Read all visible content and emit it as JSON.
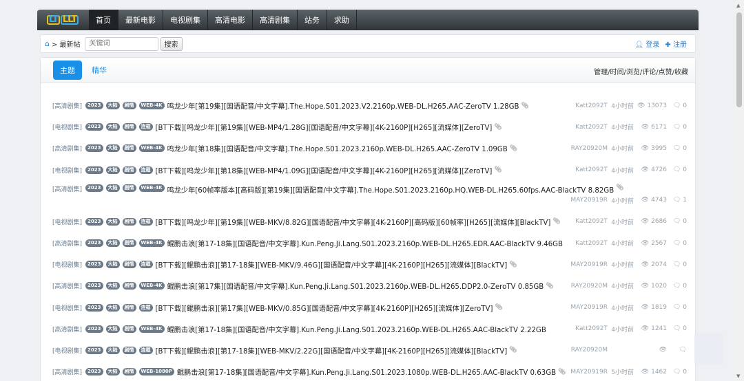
{
  "nav": {
    "logo": "LT LLT",
    "items": [
      "首页",
      "最新电影",
      "电视剧集",
      "高清电影",
      "高清剧集",
      "站务",
      "求助"
    ]
  },
  "subbar": {
    "breadcrumb": "> 最新帖",
    "search_placeholder": "关键词",
    "search_button": "搜索",
    "login": "登录",
    "register": "注册"
  },
  "tabs": {
    "main": "主题",
    "featured": "精华",
    "sort_options": "管理/时间/浏览/评论/点赞/收藏"
  },
  "colors": {
    "accent": "#1a8fe8",
    "nav_bg": "#2f3437",
    "tag_bg": "#6c7a87"
  },
  "posts": [
    {
      "cat": "[高清剧集]",
      "tags": [
        "2023",
        "大陆",
        "剧情",
        "WEB-4K"
      ],
      "title": "鸣龙少年[第19集][国语配音/中文字幕].The.Hope.S01.2023.V2.2160p.WEB-DL.H265.AAC-ZeroTV 1.28GB",
      "author": "Katt2092T",
      "time": "4小时前",
      "views": "13073",
      "comments": "0"
    },
    {
      "cat": "[电视剧集]",
      "tags": [
        "2023",
        "大陆",
        "剧情",
        "连载"
      ],
      "title": "[BT下载][鸣龙少年][第19集][WEB-MP4/1.28G][国语配音/中文字幕][4K-2160P][H265][流媒体][ZeroTV]",
      "author": "Katt2092T",
      "time": "4小时前",
      "views": "6171",
      "comments": "0"
    },
    {
      "cat": "[高清剧集]",
      "tags": [
        "2023",
        "大陆",
        "剧情",
        "WEB-4K"
      ],
      "title": "鸣龙少年[第18集][国语配音/中文字幕].The.Hope.S01.2023.2160p.WEB-DL.H265.AAC-ZeroTV 1.09GB",
      "author": "RAY20920M",
      "time": "4小时前",
      "views": "3995",
      "comments": "0"
    },
    {
      "cat": "[电视剧集]",
      "tags": [
        "2023",
        "大陆",
        "剧情",
        "连载"
      ],
      "title": "[BT下载][鸣龙少年][第18集][WEB-MP4/1.09G][国语配音/中文字幕][4K-2160P][H265][流媒体][ZeroTV]",
      "author": "Katt2092T",
      "time": "4小时前",
      "views": "4726",
      "comments": "0"
    },
    {
      "cat": "[高清剧集]",
      "tags": [
        "2023",
        "大陆",
        "剧情",
        "WEB-4K"
      ],
      "title": "鸣龙少年[60帧率版本][高码版][第19集][国语配音/中文字幕].The.Hope.S01.2023.2160p.HQ.WEB-DL.H265.60fps.AAC-BlackTV 8.82GB",
      "author": "MAY20919R",
      "time": "4小时前",
      "views": "4743",
      "comments": "1",
      "two": true
    },
    {
      "cat": "[电视剧集]",
      "tags": [
        "2023",
        "大陆",
        "剧情",
        "连载"
      ],
      "title": "[BT下载][鸣龙少年][第19集][WEB-MKV/8.82G][国语配音/中文字幕][4K-2160P][高码版][60帧率][H265][流媒体][BlackTV]",
      "author": "Katt2092T",
      "time": "4小时前",
      "views": "2686",
      "comments": "0"
    },
    {
      "cat": "[高清剧集]",
      "tags": [
        "2023",
        "大陆",
        "剧情",
        "WEB-4K"
      ],
      "title": "鲲鹏击浪[第17-18集][国语配音/中文字幕].Kun.Peng.Ji.Lang.S01.2023.2160p.WEB-DL.H265.EDR.AAC-BlackTV 9.46GB",
      "author": "Katt2092T",
      "time": "4小时前",
      "views": "2567",
      "comments": "0",
      "noclip": true
    },
    {
      "cat": "[电视剧集]",
      "tags": [
        "2023",
        "大陆",
        "剧情",
        "连载"
      ],
      "title": "[BT下载][鲲鹏击浪][第17-18集][WEB-MKV/9.46G][国语配音/中文字幕][4K-2160P][H265][流媒体][BlackTV]",
      "author": "MAY20919R",
      "time": "4小时前",
      "views": "2074",
      "comments": "0"
    },
    {
      "cat": "[高清剧集]",
      "tags": [
        "2023",
        "大陆",
        "剧情",
        "WEB-4K"
      ],
      "title": "鲲鹏击浪[第17集][国语配音/中文字幕].Kun.Peng.Ji.Lang.S01.2023.2160p.WEB-DL.H265.DDP2.0-ZeroTV 0.85GB",
      "author": "RAY20920M",
      "time": "4小时前",
      "views": "1020",
      "comments": "0"
    },
    {
      "cat": "[电视剧集]",
      "tags": [
        "2023",
        "大陆",
        "剧情",
        "连载"
      ],
      "title": "[BT下载][鲲鹏击浪][第17集][WEB-MKV/0.85G][国语配音/中文字幕][4K-2160P][H265][流媒体][ZeroTV]",
      "author": "MAY20919R",
      "time": "4小时前",
      "views": "1819",
      "comments": "0"
    },
    {
      "cat": "[高清剧集]",
      "tags": [
        "2023",
        "大陆",
        "剧情",
        "WEB-4K"
      ],
      "title": "鲲鹏击浪[第17-18集][国语配音/中文字幕].Kun.Peng.Ji.Lang.S01.2023.2160p.WEB-DL.H265.AAC-BlackTV 2.22GB",
      "author": "Katt2092T",
      "time": "4小时前",
      "views": "1241",
      "comments": "0",
      "noclip": true
    },
    {
      "cat": "[电视剧集]",
      "tags": [
        "2023",
        "大陆",
        "剧情",
        "连载"
      ],
      "title": "[BT下载][鲲鹏击浪][第17-18集][WEB-MKV/2.22G][国语配音/中文字幕][4K-2160P][H265][流媒体][BlackTV]",
      "author": "RAY20920M",
      "time": "",
      "views": "",
      "comments": ""
    },
    {
      "cat": "[高清剧集]",
      "tags": [
        "2023",
        "大陆",
        "剧情",
        "WEB-1080P"
      ],
      "title": "鲲鹏击浪[第17-18集][国语配音/中文字幕].Kun.Peng.Ji.Lang.S01.2023.1080p.WEB-DL.H265.AAC-BlackTV 0.63GB",
      "author": "MAY20919R",
      "time": "5小时前",
      "views": "1462",
      "comments": "0"
    }
  ]
}
